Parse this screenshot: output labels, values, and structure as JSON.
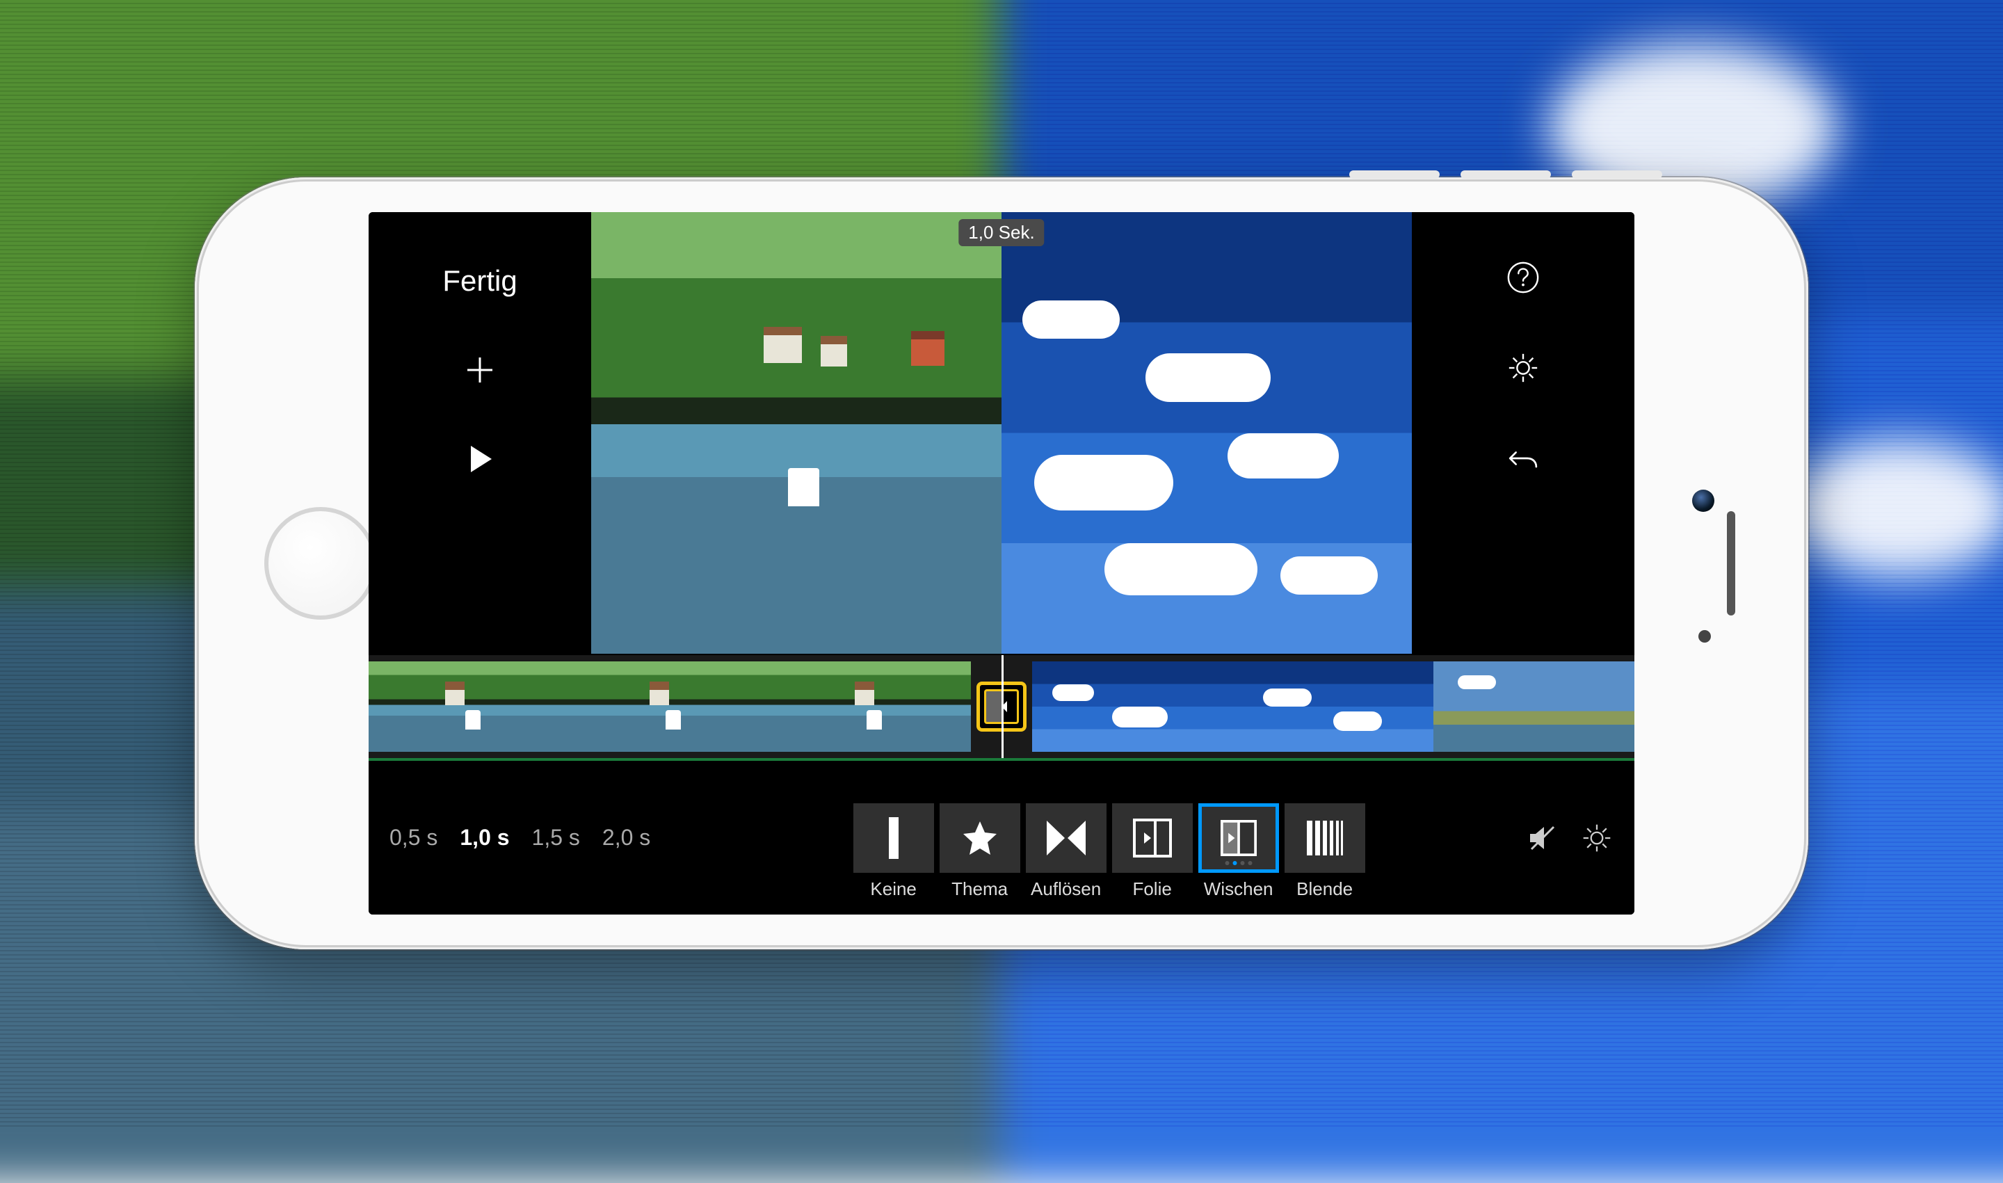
{
  "header": {
    "done_label": "Fertig",
    "duration_badge": "1,0 Sek."
  },
  "preview": {
    "left_clip": "river-canal-scene",
    "right_clip": "sky-clouds-scene"
  },
  "timeline": {
    "transition_selected": true
  },
  "durations": {
    "options": [
      "0,5 s",
      "1,0 s",
      "1,5 s",
      "2,0 s"
    ],
    "selected_index": 1
  },
  "transitions": [
    {
      "id": "none",
      "label": "Keine",
      "selected": false
    },
    {
      "id": "theme",
      "label": "Thema",
      "selected": false
    },
    {
      "id": "dissolve",
      "label": "Auflösen",
      "selected": false
    },
    {
      "id": "slide",
      "label": "Folie",
      "selected": false
    },
    {
      "id": "wipe",
      "label": "Wischen",
      "selected": true
    },
    {
      "id": "fade",
      "label": "Blende",
      "selected": false
    }
  ],
  "icons": {
    "help": "help",
    "settings": "gear",
    "undo": "undo",
    "add": "plus",
    "play": "play",
    "mute": "mute",
    "project_settings": "gear"
  }
}
